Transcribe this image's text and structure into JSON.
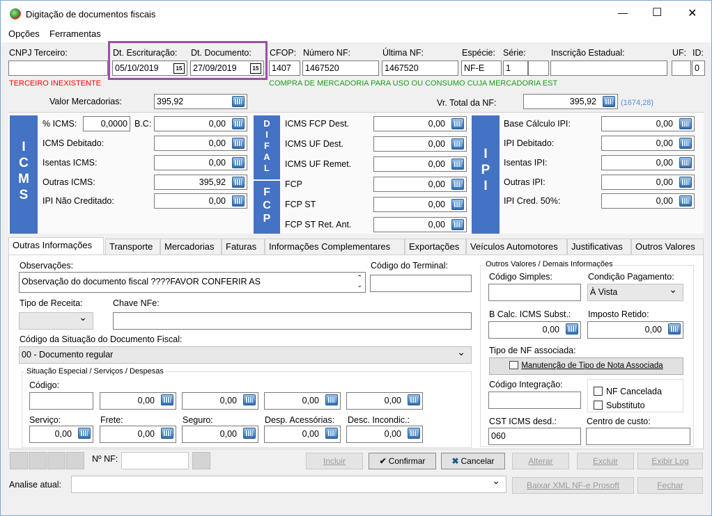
{
  "window": {
    "title": "Digitação de documentos fiscais",
    "min": "—",
    "max": "☐",
    "close": "✕"
  },
  "menu": {
    "opcoes": "Opções",
    "ferramentas": "Ferramentas"
  },
  "header": {
    "cnpj_label": "CNPJ Terceiro:",
    "cnpj_value": "",
    "dt_escrit_label": "Dt. Escrituração:",
    "dt_escrit_value": "05/10/2019",
    "dt_doc_label": "Dt. Documento:",
    "dt_doc_value": "27/09/2019",
    "cal_icon": "15",
    "cfop_label": "CFOP:",
    "cfop_value": "1407",
    "numero_label": "Número NF:",
    "numero_value": "1467520",
    "ultima_label": "Última NF:",
    "ultima_value": "1467520",
    "especie_label": "Espécie:",
    "especie_value": "NF-E",
    "serie_label": "Série:",
    "serie_value": "1",
    "ie_label": "Inscrição Estadual:",
    "ie_value": "",
    "uf_label": "UF:",
    "id_label": "ID:",
    "id_value": "0",
    "terceiro_msg": "TERCEIRO INEXISTENTE",
    "cfop_msg": "COMPRA DE MERCADORIA PARA USO OU CONSUMO CUJA MERCADORIA EST",
    "valor_merc_label": "Valor Mercadorias:",
    "valor_merc_value": "395,92",
    "vr_total_label": "Vr. Total da NF:",
    "vr_total_value": "395,92",
    "vr_total_note": "(1674,28)"
  },
  "icms": {
    "bar": "ICMS",
    "pct_label": "% ICMS:",
    "pct_value": "0,0000",
    "bc_label": "B.C:",
    "bc_value": "0,00",
    "debitado_label": "ICMS Debitado:",
    "debitado_value": "0,00",
    "isentas_label": "Isentas ICMS:",
    "isentas_value": "0,00",
    "outras_label": "Outras ICMS:",
    "outras_value": "395,92",
    "ipinc_label": "IPI Não Creditado:",
    "ipinc_value": "0,00"
  },
  "difal": {
    "bar": "DIFAL",
    "bar2": "FCP",
    "fcpdest_label": "ICMS FCP Dest.",
    "fcpdest_value": "0,00",
    "ufdest_label": "ICMS UF Dest.",
    "ufdest_value": "0,00",
    "ufremet_label": "ICMS UF Remet.",
    "ufremet_value": "0,00",
    "fcp_label": "FCP",
    "fcp_value": "0,00",
    "fcpst_label": "FCP ST",
    "fcpst_value": "0,00",
    "fcpstret_label": "FCP ST Ret. Ant.",
    "fcpstret_value": "0,00"
  },
  "ipi": {
    "bar": "IPI",
    "base_label": "Base Cálculo IPI:",
    "base_value": "0,00",
    "deb_label": "IPI Debitado:",
    "deb_value": "0,00",
    "isentas_label": "Isentas IPI:",
    "isentas_value": "0,00",
    "outras_label": "Outras IPI:",
    "outras_value": "0,00",
    "cred_label": "IPI Cred. 50%:",
    "cred_value": "0,00"
  },
  "tabs": [
    "Outras Informações",
    "Transporte",
    "Mercadorias",
    "Faturas",
    "Informações Complementares",
    "Exportações",
    "Veículos Automotores",
    "Justificativas",
    "Outros Valores"
  ],
  "outras": {
    "obs_label": "Observações:",
    "obs_value": "Observação do documento fiscal ????FAVOR CONFERIR AS",
    "terminal_label": "Código do Terminal:",
    "terminal_value": "",
    "tipo_receita_label": "Tipo de Receita:",
    "tipo_receita_value": "",
    "chave_label": "Chave NFe:",
    "chave_value": "",
    "situacao_label": "Código da Situação do Documento Fiscal:",
    "situacao_value": "00 - Documento regular",
    "esp_title": "Situação Especial / Serviços / Despesas",
    "codigo_label": "Código:",
    "row1": [
      "0,00",
      "0,00",
      "0,00",
      "0,00"
    ],
    "servico_label": "Serviço:",
    "servico_value": "0,00",
    "frete_label": "Frete:",
    "frete_value": "0,00",
    "seguro_label": "Seguro:",
    "seguro_value": "0,00",
    "desp_label": "Desp. Acessórias:",
    "desp_value": "0,00",
    "desc_label": "Desc. Incondic.:",
    "desc_value": "0,00"
  },
  "demais": {
    "title": "Outros Valores / Demais Informações",
    "cod_simples_label": "Código Simples:",
    "cod_simples_value": "",
    "cond_pag_label": "Condição Pagamento:",
    "cond_pag_value": "À Vista",
    "bcalc_label": "B Calc. ICMS Subst.:",
    "bcalc_value": "0,00",
    "imposto_label": "Imposto Retido:",
    "imposto_value": "0,00",
    "tipo_nf_label": "Tipo de NF associada:",
    "manut_button": "Manutenção de Tipo de Nota Associada",
    "cod_integ_label": "Código Integração:",
    "cod_integ_value": "",
    "nf_cancelada": "NF Cancelada",
    "substituto": "Substituto",
    "cst_label": "CST ICMS desd.:",
    "cst_value": "060",
    "centro_label": "Centro de custo:",
    "centro_value": ""
  },
  "footer": {
    "nf_label": "Nº NF:",
    "nf_value": "",
    "incluir": "Incluir",
    "confirmar": "Confirmar",
    "cancelar": "Cancelar",
    "alterar": "Alterar",
    "excluir": "Excluir",
    "exibir_log": "Exibir Log",
    "analise_label": "Analise atual:",
    "analise_value": "",
    "baixar_xml": "Baixar XML NF-e Prosoft",
    "fechar": "Fechar"
  },
  "colors": {
    "accent_bar": "#4472c4",
    "highlight_box": "#9b4fa8",
    "error_text": "#ff0000",
    "ok_text": "#1a9a1a",
    "note_text": "#5a8ed8"
  }
}
